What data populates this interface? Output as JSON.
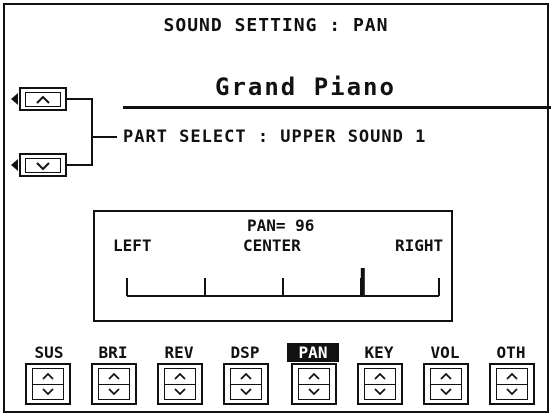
{
  "header": {
    "title": "SOUND SETTING : PAN"
  },
  "sound": {
    "name": "Grand Piano"
  },
  "part_select": {
    "text": "PART SELECT : UPPER SOUND 1"
  },
  "pan": {
    "value_text": "PAN= 96",
    "value": 96,
    "range": [
      0,
      127
    ],
    "left_label": "LEFT",
    "center_label": "CENTER",
    "right_label": "RIGHT"
  },
  "tabs": [
    {
      "label": "SUS",
      "active": false
    },
    {
      "label": "BRI",
      "active": false
    },
    {
      "label": "REV",
      "active": false
    },
    {
      "label": "DSP",
      "active": false
    },
    {
      "label": "PAN",
      "active": true
    },
    {
      "label": "KEY",
      "active": false
    },
    {
      "label": "VOL",
      "active": false
    },
    {
      "label": "OTH",
      "active": false
    }
  ]
}
